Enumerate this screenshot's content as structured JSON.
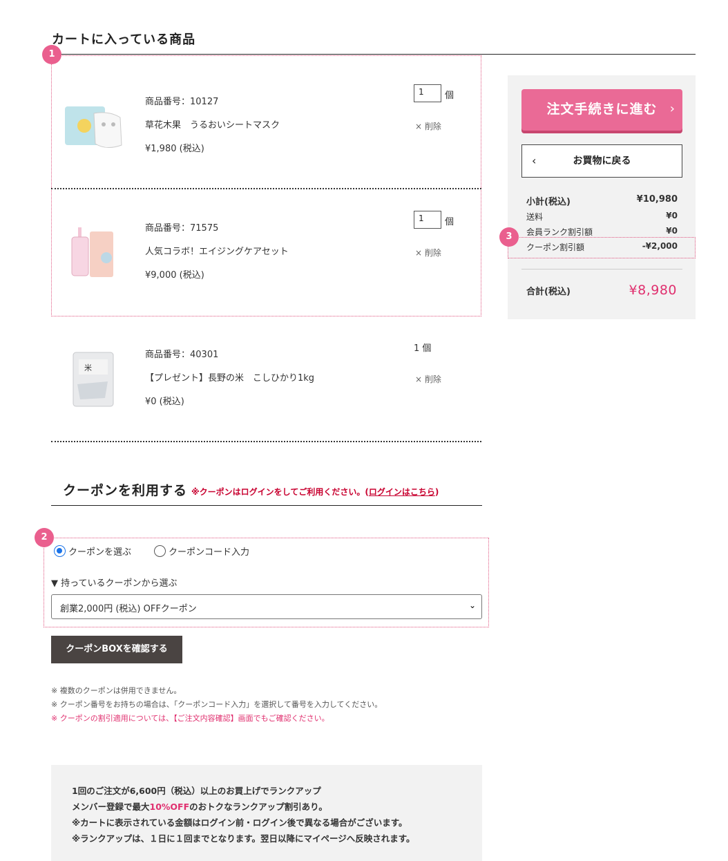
{
  "cart": {
    "title": "カートに入っている商品",
    "items": [
      {
        "code": "商品番号：10127",
        "name": "草花木果　うるおいシートマスク",
        "price": "¥1,980 (税込)",
        "qty": "1",
        "unit": "個",
        "delete_label": "× 削除",
        "image": "sheet-mask-product-image"
      },
      {
        "code": "商品番号：71575",
        "name": "人気コラボ！エイジングケアセット",
        "price": "¥9,000 (税込)",
        "qty": "1",
        "unit": "個",
        "delete_label": "× 削除",
        "image": "aging-care-set-image"
      },
      {
        "code": "商品番号：40301",
        "name": "【プレゼント】長野の米　こしひかり1kg",
        "price": "¥0 (税込)",
        "qty_text": "1 個",
        "delete_label": "× 削除",
        "image": "rice-bag-image"
      }
    ]
  },
  "markers": {
    "one": "1",
    "two": "2",
    "three": "3"
  },
  "summary": {
    "order_button": "注文手続きに進む",
    "back_button": "お買物に戻る",
    "rows": [
      {
        "label": "小計(税込)",
        "value": "¥10,980"
      },
      {
        "label": "送料",
        "value": "¥0"
      },
      {
        "label": "会員ランク割引額",
        "value": "¥0"
      },
      {
        "label": "クーポン割引額",
        "value": "-¥2,000"
      }
    ],
    "total_label": "合計(税込)",
    "total_value": "¥8,980"
  },
  "coupon": {
    "title": "クーポンを利用する",
    "note_prefix": "※クーポンはログインをしてご利用ください。(",
    "note_link": "ログインはこちら",
    "note_suffix": ")",
    "radio_select": "クーポンを選ぶ",
    "radio_code": "クーポンコード入力",
    "owned_label": "▼ 持っているクーポンから選ぶ",
    "selected": "創業2,000円 (税込) OFFクーポン",
    "box_button": "クーポンBOXを確認する",
    "notes": [
      "※ 複数のクーポンは併用できません。",
      "※ クーポン番号をお持ちの場合は、「クーポンコード入力」を選択して番号を入力してください。",
      "※ クーポンの割引適用については、【ご注文内容確認】画面でもご確認ください。"
    ]
  },
  "info": {
    "line1": "1回のご注文が6,600円（税込）以上のお買上げでランクアップ",
    "line2_prefix": "メンバー登録で最大",
    "line2_highlight": "10%OFF",
    "line2_suffix": "のおトクなランクアップ割引あり。",
    "line3": "※カートに表示されている金額はログイン前・ログイン後で異なる場合がございます。",
    "line4": "※ランクアップは、１日に１回までとなります。翌日以降にマイページへ反映されます。"
  },
  "colors": {
    "accent": "#ea6a96",
    "price_pink": "#e0306f",
    "warning_red": "#c8002f",
    "dark_button": "#4a4442"
  }
}
